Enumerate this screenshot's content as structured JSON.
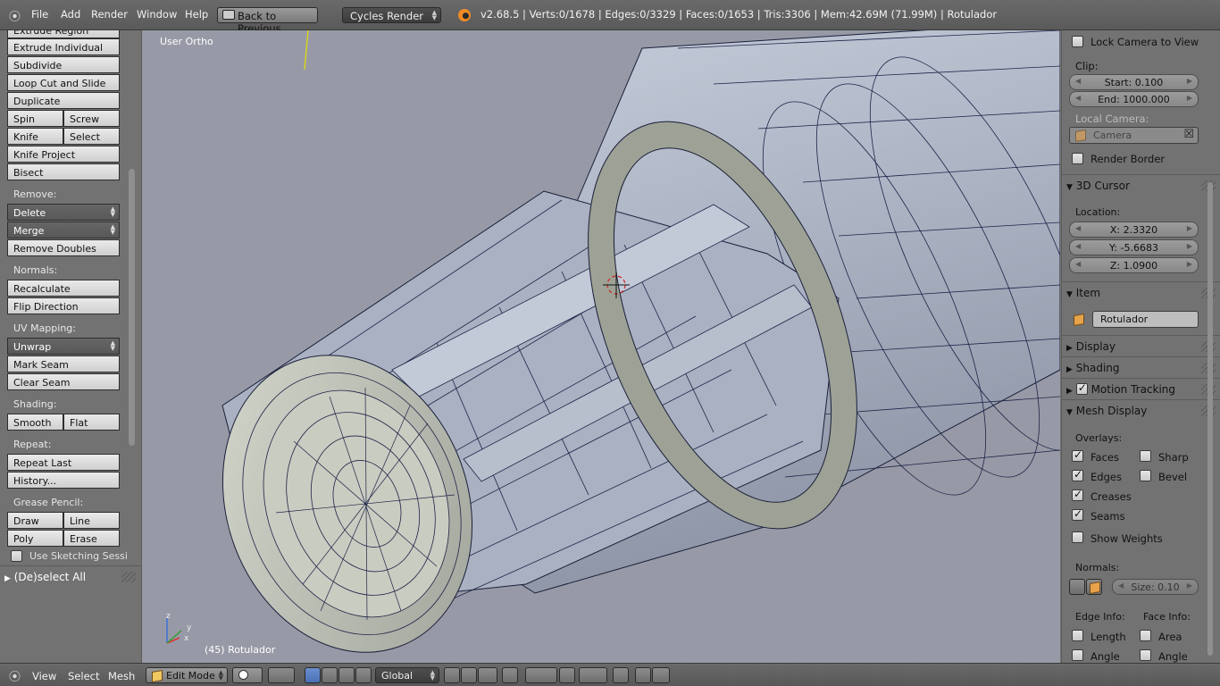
{
  "menubar": {
    "file": "File",
    "add": "Add",
    "render": "Render",
    "window": "Window",
    "help": "Help",
    "back_button": "Back to Previous",
    "render_engine": "Cycles Render",
    "stats": "v2.68.5 | Verts:0/1678 | Edges:0/3329 | Faces:0/1653 | Tris:3306 | Mem:42.69M (71.99M) | Rotulador"
  },
  "tools": {
    "extrude_region": "Extrude Region",
    "extrude_individual": "Extrude Individual",
    "subdivide": "Subdivide",
    "loop_cut": "Loop Cut and Slide",
    "duplicate": "Duplicate",
    "spin": "Spin",
    "screw": "Screw",
    "knife": "Knife",
    "select": "Select",
    "knife_project": "Knife Project",
    "bisect": "Bisect",
    "remove_label": "Remove:",
    "delete": "Delete",
    "merge": "Merge",
    "remove_doubles": "Remove Doubles",
    "normals_label": "Normals:",
    "recalculate": "Recalculate",
    "flip_direction": "Flip Direction",
    "uv_label": "UV Mapping:",
    "unwrap": "Unwrap",
    "mark_seam": "Mark Seam",
    "clear_seam": "Clear Seam",
    "shading_label": "Shading:",
    "smooth": "Smooth",
    "flat": "Flat",
    "repeat_label": "Repeat:",
    "repeat_last": "Repeat Last",
    "history": "History...",
    "grease_label": "Grease Pencil:",
    "draw": "Draw",
    "line": "Line",
    "poly": "Poly",
    "erase": "Erase",
    "use_sketching": "Use Sketching Sessi",
    "deselect_all": "(De)select All"
  },
  "viewport": {
    "view_name": "User Ortho",
    "object_info": "(45) Rotulador",
    "axis_x": "x",
    "axis_y": "y",
    "axis_z": "z"
  },
  "props": {
    "lock_camera": "Lock Camera to View",
    "clip_label": "Clip:",
    "clip_start": "Start: 0.100",
    "clip_end": "End: 1000.000",
    "local_camera_label": "Local Camera:",
    "camera": "Camera",
    "render_border": "Render Border",
    "cursor_header": "3D Cursor",
    "location_label": "Location:",
    "cursor_x": "X: 2.3320",
    "cursor_y": "Y: -5.6683",
    "cursor_z": "Z: 1.0900",
    "item_header": "Item",
    "item_name": "Rotulador",
    "display_header": "Display",
    "shading_header": "Shading",
    "motion_tracking_header": "Motion Tracking",
    "mesh_display_header": "Mesh Display",
    "overlays_label": "Overlays:",
    "faces": "Faces",
    "sharp": "Sharp",
    "edges": "Edges",
    "bevel": "Bevel",
    "creases": "Creases",
    "seams": "Seams",
    "show_weights": "Show Weights",
    "normals_label": "Normals:",
    "normal_size": "Size: 0.10",
    "edge_info_label": "Edge Info:",
    "face_info_label": "Face Info:",
    "length": "Length",
    "area": "Area",
    "angle_edge": "Angle",
    "angle_face": "Angle"
  },
  "bottombar": {
    "view": "View",
    "select": "Select",
    "mesh": "Mesh",
    "mode": "Edit Mode",
    "orientation": "Global"
  }
}
